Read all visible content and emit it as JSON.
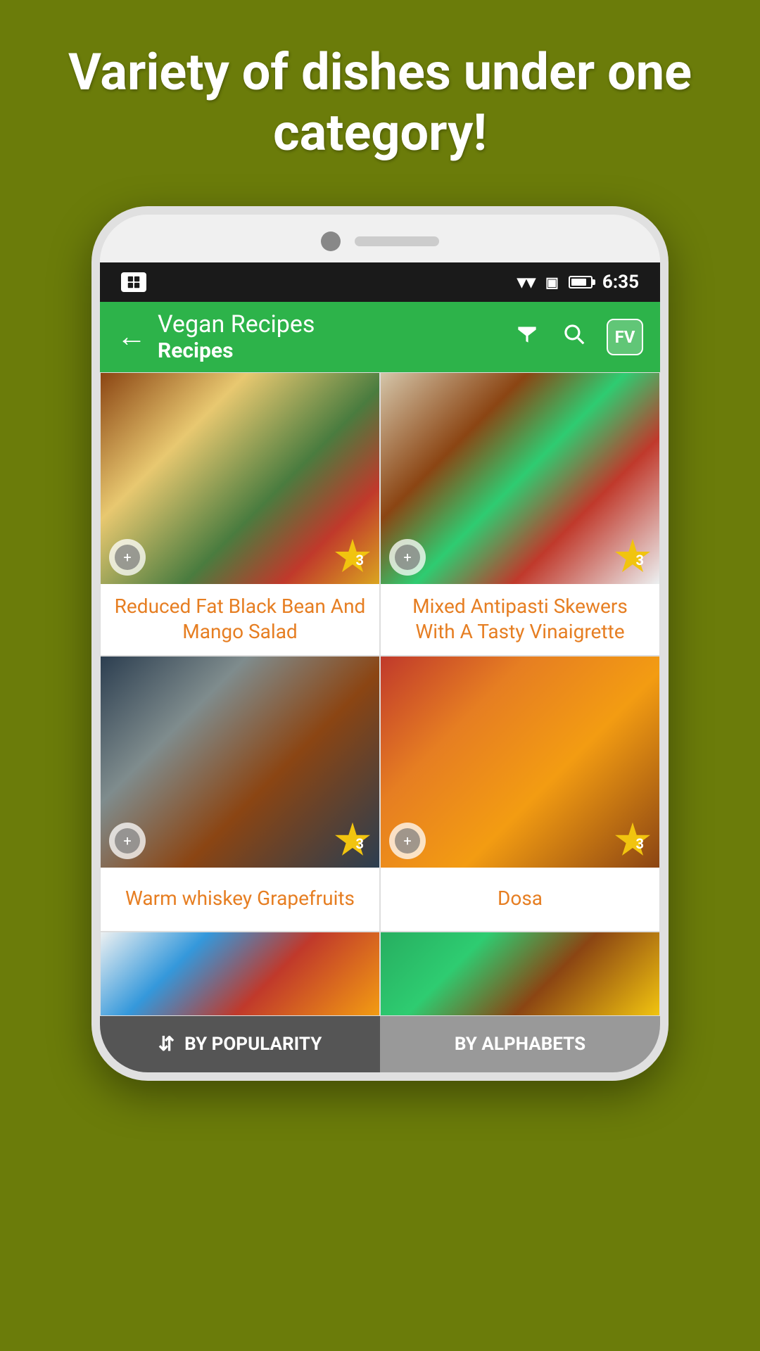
{
  "hero": {
    "text": "Variety of dishes under one category!"
  },
  "statusBar": {
    "time": "6:35"
  },
  "toolbar": {
    "appName": "Vegan Recipes",
    "sectionName": "Recipes",
    "fvLabel": "FV"
  },
  "recipes": [
    {
      "id": 1,
      "title": "Reduced Fat Black Bean And Mango Salad",
      "rating": "3",
      "imageClass": "food-img-1"
    },
    {
      "id": 2,
      "title": "Mixed Antipasti Skewers With A Tasty Vinaigrette",
      "rating": "3",
      "imageClass": "food-img-2"
    },
    {
      "id": 3,
      "title": "Warm whiskey Grapefruits",
      "rating": "3",
      "imageClass": "food-img-3"
    },
    {
      "id": 4,
      "title": "Dosa",
      "rating": "3",
      "imageClass": "food-img-4"
    }
  ],
  "partialCards": [
    {
      "id": 5,
      "imageClass": "food-img-5"
    },
    {
      "id": 6,
      "imageClass": "food-img-6"
    }
  ],
  "bottomNav": [
    {
      "id": "popularity",
      "label": "BY POPULARITY",
      "active": true
    },
    {
      "id": "alphabets",
      "label": "BY ALPHABETS",
      "active": false
    }
  ]
}
